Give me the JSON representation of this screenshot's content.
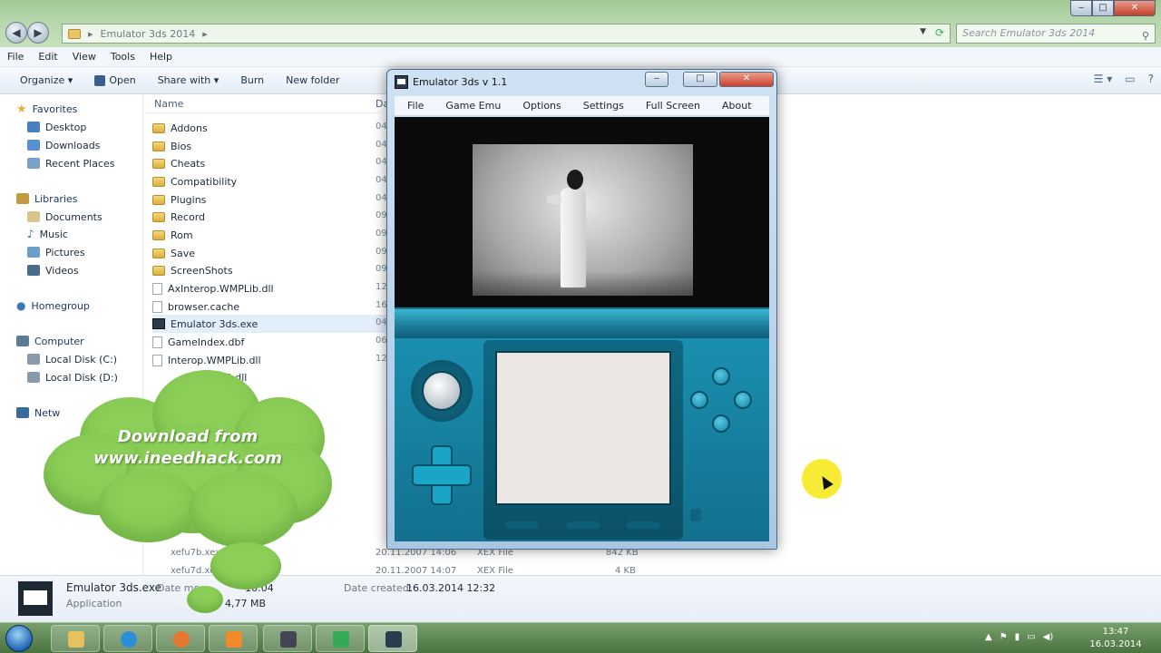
{
  "explorer": {
    "address": {
      "path_segment": "Emulator 3ds 2014",
      "separator_left": "▸",
      "separator_right": "▸"
    },
    "search": {
      "placeholder": "Search Emulator 3ds 2014"
    },
    "menu": [
      "File",
      "Edit",
      "View",
      "Tools",
      "Help"
    ],
    "commands": {
      "organize": "Organize ▾",
      "open": "Open",
      "share_with": "Share with ▾",
      "burn": "Burn",
      "new_folder": "New folder"
    },
    "nav": {
      "favorites": "Favorites",
      "favorites_items": [
        "Desktop",
        "Downloads",
        "Recent Places"
      ],
      "libraries": "Libraries",
      "libraries_items": [
        "Documents",
        "Music",
        "Pictures",
        "Videos"
      ],
      "homegroup": "Homegroup",
      "computer": "Computer",
      "computer_items": [
        "Local Disk (C:)",
        "Local Disk (D:)"
      ],
      "network": "Netw"
    },
    "columns": {
      "name": "Name",
      "date": "Da"
    },
    "files": [
      {
        "name": "Addons",
        "type": "folder",
        "date": "04"
      },
      {
        "name": "Bios",
        "type": "folder",
        "date": "04"
      },
      {
        "name": "Cheats",
        "type": "folder",
        "date": "04"
      },
      {
        "name": "Compatibility",
        "type": "folder",
        "date": "04"
      },
      {
        "name": "Plugins",
        "type": "folder",
        "date": "04"
      },
      {
        "name": "Record",
        "type": "folder",
        "date": "09"
      },
      {
        "name": "Rom",
        "type": "folder",
        "date": "09"
      },
      {
        "name": "Save",
        "type": "folder",
        "date": "09"
      },
      {
        "name": "ScreenShots",
        "type": "folder",
        "date": "09"
      },
      {
        "name": "AxInterop.WMPLib.dll",
        "type": "file",
        "date": "12"
      },
      {
        "name": "browser.cache",
        "type": "file",
        "date": "16"
      },
      {
        "name": "Emulator 3ds.exe",
        "type": "exe",
        "date": "04"
      },
      {
        "name": "GameIndex.dbf",
        "type": "file",
        "date": "06"
      },
      {
        "name": "Interop.WMPLib.dll",
        "type": "file",
        "date": "12"
      },
      {
        "name": "ds.v3.dll",
        "type": "file",
        "date": ""
      }
    ],
    "bottom_rows": [
      {
        "name": "xefu7b.xex",
        "date": "20.11.2007 14:06",
        "type": "XEX File",
        "size": "842 KB"
      },
      {
        "name": "xefu7d.xex",
        "date": "20.11.2007 14:07",
        "type": "XEX File",
        "size": "4 KB"
      }
    ],
    "details": {
      "name": "Emulator 3ds.exe",
      "type": "Application",
      "modified_label": "Date mo",
      "modified_value": "16:04",
      "size": "4,77 MB",
      "created_label": "Date created:",
      "created_value": "16.03.2014 12:32"
    }
  },
  "emulator": {
    "title": "Emulator 3ds v 1.1",
    "menu": [
      "File",
      "Game Emu",
      "Options",
      "Settings",
      "Full Screen",
      "About"
    ]
  },
  "promo": {
    "line1": "Download from",
    "line2": "www.ineedhack.com"
  },
  "taskbar": {
    "time": "13:47",
    "date": "16.03.2014"
  },
  "colors": {
    "cloud": "#8ccf58",
    "device_teal": "#147a98",
    "cursor_highlight": "#f7ea2b"
  }
}
